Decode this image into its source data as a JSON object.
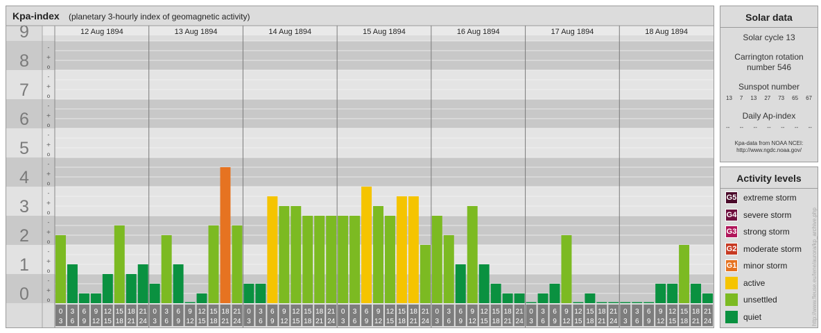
{
  "header": {
    "title": "Kpa-index",
    "subtitle": "(planetary 3-hourly index of geomagnetic activity)"
  },
  "chart_data": {
    "type": "bar",
    "ylim": [
      0,
      9
    ],
    "y_ticks": [
      "0",
      "1",
      "2",
      "3",
      "4",
      "5",
      "6",
      "7",
      "8",
      "9"
    ],
    "minor_ticks": [
      "o",
      "+",
      "-"
    ],
    "days": [
      "12 Aug 1894",
      "13 Aug 1894",
      "14 Aug 1894",
      "15 Aug 1894",
      "16 Aug 1894",
      "17 Aug 1894",
      "18 Aug 1894"
    ],
    "interval_starts": [
      "0",
      "3",
      "6",
      "9",
      "12",
      "15",
      "18",
      "21"
    ],
    "interval_ends": [
      "3",
      "6",
      "9",
      "12",
      "15",
      "18",
      "21",
      "24"
    ],
    "values": [
      [
        2.333,
        1.333,
        0.333,
        0.333,
        1.0,
        2.667,
        1.0,
        1.333
      ],
      [
        0.667,
        2.333,
        1.333,
        0.0,
        0.333,
        2.667,
        4.667,
        2.667
      ],
      [
        0.667,
        0.667,
        3.667,
        3.333,
        3.333,
        3.0,
        3.0,
        3.0
      ],
      [
        3.0,
        3.0,
        4.0,
        3.333,
        3.0,
        3.667,
        3.667,
        2.0
      ],
      [
        3.0,
        2.333,
        1.333,
        3.333,
        1.333,
        0.667,
        0.333,
        0.333
      ],
      [
        0.0,
        0.333,
        0.667,
        2.333,
        0.0,
        0.333,
        0.0,
        0.0
      ],
      [
        0.0,
        0.0,
        0.0,
        0.667,
        0.667,
        2.0,
        0.667,
        0.333
      ]
    ]
  },
  "solar": {
    "title": "Solar data",
    "cycle": "Solar cycle 13",
    "carrington_line1": "Carrington rotation",
    "carrington_line2": "number 546",
    "sunspot_title": "Sunspot number",
    "sunspot_values": [
      "13",
      "7",
      "13",
      "27",
      "73",
      "65",
      "67"
    ],
    "ap_title": "Daily Ap-index",
    "ap_values": [
      "--",
      "--",
      "--",
      "--",
      "--",
      "--",
      "--"
    ],
    "source_line1": "Kpa-data from NOAA NCEI:",
    "source_line2": "http://www.ngdc.noaa.gov/"
  },
  "activity": {
    "title": "Activity levels",
    "levels": [
      {
        "code": "G5",
        "label": "extreme storm",
        "color": "#4a0a2a"
      },
      {
        "code": "G4",
        "label": "severe storm",
        "color": "#6e0f3e"
      },
      {
        "code": "G3",
        "label": "strong storm",
        "color": "#b0155a"
      },
      {
        "code": "G2",
        "label": "moderate storm",
        "color": "#c73a23"
      },
      {
        "code": "G1",
        "label": "minor storm",
        "color": "#e67321"
      },
      {
        "code": "",
        "label": "active",
        "color": "#f5c400"
      },
      {
        "code": "",
        "label": "unsettled",
        "color": "#7cba22"
      },
      {
        "code": "",
        "label": "quiet",
        "color": "#0a9140"
      }
    ]
  },
  "watermark": "http://www.fleuse.eu/lene/aurora/kp_archive.php"
}
